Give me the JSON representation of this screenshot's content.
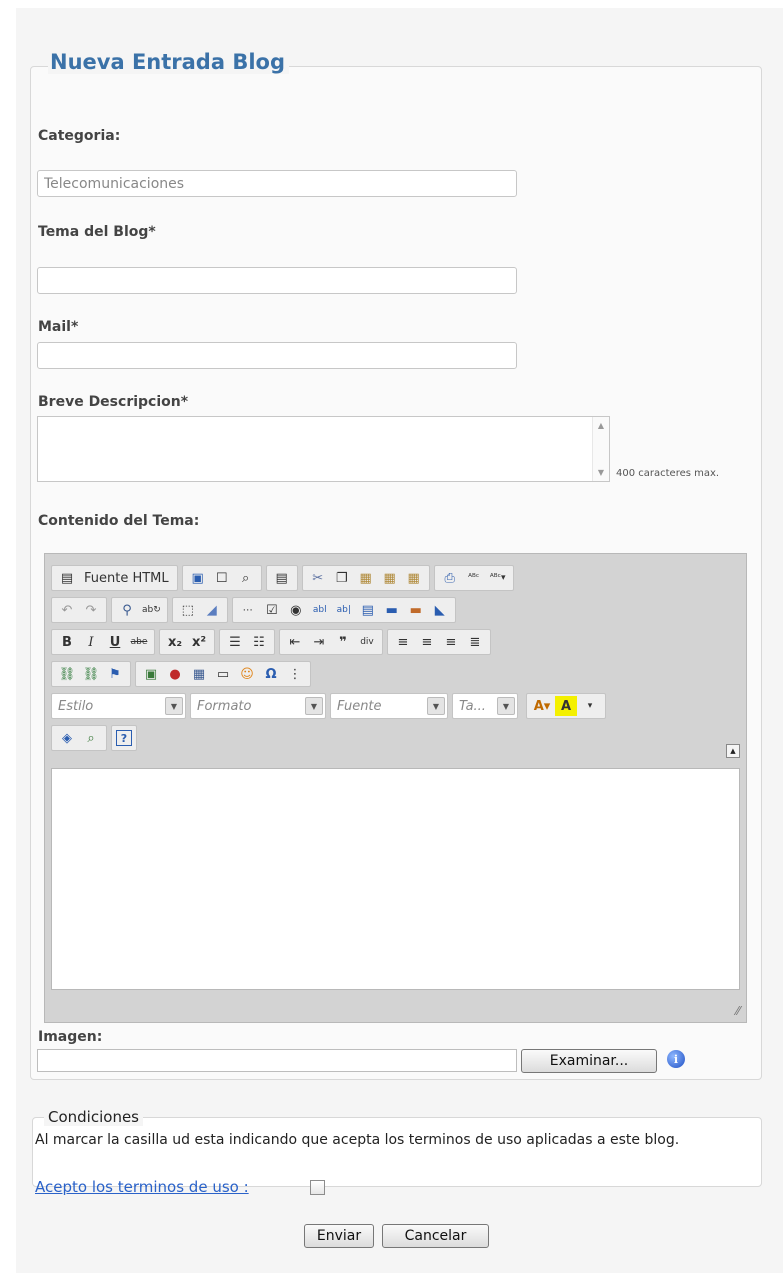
{
  "form": {
    "title": "Nueva Entrada Blog",
    "categoria_label": "Categoria:",
    "categoria_value": "Telecomunicaciones",
    "tema_label": "Tema del Blog*",
    "tema_value": "",
    "mail_label": "Mail*",
    "mail_value": "",
    "descripcion_label": "Breve Descripcion*",
    "descripcion_hint": "400 caracteres max.",
    "contenido_label": "Contenido del Tema:",
    "imagen_label": "Imagen:",
    "examinar_button": "Examinar...",
    "info_glyph": "i"
  },
  "editor": {
    "source_button": "Fuente HTML",
    "combos": {
      "estilo": "Estilo",
      "formato": "Formato",
      "fuente": "Fuente",
      "tamano": "Ta..."
    },
    "icons": [
      "save-icon",
      "new-page-icon",
      "preview-icon",
      "templates-icon",
      "cut-icon",
      "copy-icon",
      "paste-icon",
      "paste-text-icon",
      "paste-word-icon",
      "print-icon",
      "spellcheck-icon",
      "spellcheck-as-you-type-icon",
      "undo-icon",
      "redo-icon",
      "find-icon",
      "replace-icon",
      "select-all-icon",
      "remove-format-icon",
      "form-icon",
      "checkbox-icon",
      "radio-icon",
      "textfield-icon",
      "textarea-icon",
      "select-icon",
      "button-icon",
      "image-button-icon",
      "hidden-field-icon",
      "bold-icon",
      "italic-icon",
      "underline-icon",
      "strike-icon",
      "subscript-icon",
      "superscript-icon",
      "numbered-list-icon",
      "bulleted-list-icon",
      "outdent-icon",
      "indent-icon",
      "blockquote-icon",
      "create-div-icon",
      "align-left-icon",
      "align-center-icon",
      "align-right-icon",
      "justify-icon",
      "link-icon",
      "unlink-icon",
      "anchor-icon",
      "image-icon",
      "flash-icon",
      "table-icon",
      "horizontal-rule-icon",
      "smiley-icon",
      "special-char-icon",
      "page-break-icon",
      "text-color-icon",
      "background-color-icon",
      "maximize-icon",
      "show-blocks-icon",
      "about-icon"
    ]
  },
  "condiciones": {
    "legend": "Condiciones",
    "text": "Al marcar la casilla ud esta indicando que acepta los terminos de uso aplicadas a este blog.",
    "accept_link": "Acepto los terminos de uso :"
  },
  "actions": {
    "enviar": "Enviar",
    "cancelar": "Cancelar"
  },
  "colors": {
    "title": "#3b72a8",
    "link": "#2a62c9",
    "editor_chrome": "#d3d3d3"
  }
}
